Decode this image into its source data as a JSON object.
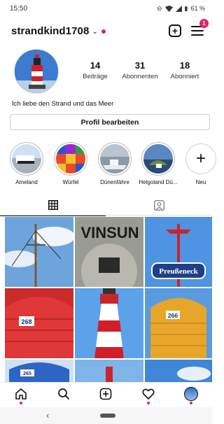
{
  "status": {
    "time": "15:50",
    "battery": "61 %",
    "icons": [
      "do-not-disturb-icon",
      "wifi-icon",
      "signal-icon",
      "battery-icon"
    ]
  },
  "header": {
    "username": "strandkind1708",
    "notification_count": "1",
    "icons": [
      "chevron-down-icon",
      "add-post-icon",
      "menu-icon"
    ]
  },
  "profile": {
    "stats": [
      {
        "value": "14",
        "label": "Beiträge"
      },
      {
        "value": "31",
        "label": "Abonnenten"
      },
      {
        "value": "18",
        "label": "Abonniert"
      }
    ],
    "bio": "Ich liebe den Strand und das Meer",
    "edit_label": "Profil bearbeiten"
  },
  "highlights": [
    {
      "label": "Ameland"
    },
    {
      "label": "Würfel"
    },
    {
      "label": "Dünenfähre"
    },
    {
      "label": "Helgoland Dü..."
    }
  ],
  "new_highlight_label": "Neu",
  "tabs": [
    "grid-icon",
    "tagged-icon"
  ],
  "grid_texts": {
    "tile2": "VINSUN",
    "tile3": "Preußeneck",
    "tile4": "268",
    "tile6": "266",
    "tile7": "265"
  },
  "bottom_nav": [
    "home-icon",
    "search-icon",
    "create-icon",
    "heart-icon",
    "profile-avatar"
  ],
  "colors": {
    "accent_red": "#e0245e",
    "border": "#cfcfcf"
  }
}
